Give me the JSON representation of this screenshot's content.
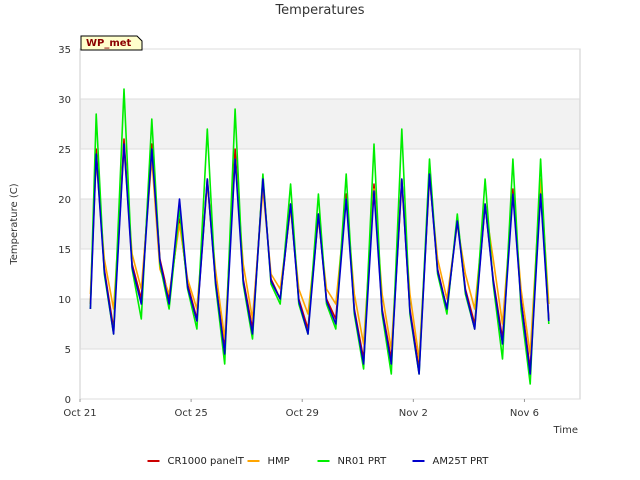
{
  "chart_data": {
    "type": "line",
    "title": "Temperatures",
    "xlabel": "Time",
    "ylabel": "Temperature (C)",
    "badge": "WP_met",
    "ylim": [
      0,
      35
    ],
    "yticks": [
      0,
      5,
      10,
      15,
      20,
      25,
      30,
      35
    ],
    "xlim": [
      "2024-10-21",
      "2024-11-08"
    ],
    "xticks": [
      {
        "date": "2024-10-21",
        "label": "Oct 21"
      },
      {
        "date": "2024-10-25",
        "label": "Oct 25"
      },
      {
        "date": "2024-10-29",
        "label": "Oct 29"
      },
      {
        "date": "2024-11-02",
        "label": "Nov 2"
      },
      {
        "date": "2024-11-06",
        "label": "Nov 6"
      }
    ],
    "grid": true,
    "legend_position": "bottom",
    "x": [
      "2024-10-21 09:00",
      "2024-10-21 14:00",
      "2024-10-21 21:00",
      "2024-10-22 05:00",
      "2024-10-22 14:00",
      "2024-10-22 21:00",
      "2024-10-23 05:00",
      "2024-10-23 14:00",
      "2024-10-23 21:00",
      "2024-10-24 05:00",
      "2024-10-24 14:00",
      "2024-10-24 21:00",
      "2024-10-25 05:00",
      "2024-10-25 14:00",
      "2024-10-25 21:00",
      "2024-10-26 05:00",
      "2024-10-26 14:00",
      "2024-10-26 21:00",
      "2024-10-27 05:00",
      "2024-10-27 14:00",
      "2024-10-27 21:00",
      "2024-10-28 05:00",
      "2024-10-28 14:00",
      "2024-10-28 21:00",
      "2024-10-29 05:00",
      "2024-10-29 14:00",
      "2024-10-29 21:00",
      "2024-10-30 05:00",
      "2024-10-30 14:00",
      "2024-10-30 21:00",
      "2024-10-31 05:00",
      "2024-10-31 14:00",
      "2024-10-31 21:00",
      "2024-11-01 05:00",
      "2024-11-01 14:00",
      "2024-11-01 21:00",
      "2024-11-02 05:00",
      "2024-11-02 14:00",
      "2024-11-02 21:00",
      "2024-11-03 05:00",
      "2024-11-03 14:00",
      "2024-11-03 21:00",
      "2024-11-04 05:00",
      "2024-11-04 14:00",
      "2024-11-04 21:00",
      "2024-11-05 05:00",
      "2024-11-05 14:00",
      "2024-11-05 21:00",
      "2024-11-06 05:00",
      "2024-11-06 14:00",
      "2024-11-06 21:00",
      "2024-11-07 05:00",
      "2024-11-07 14:00",
      "2024-11-07 21:00"
    ],
    "series": [
      {
        "name": "CR1000 panelT",
        "color": "#cc0000",
        "values": [
          9.5,
          25.0,
          13.0,
          7.0,
          26.0,
          13.5,
          10.0,
          25.5,
          14.0,
          10.0,
          18.0,
          11.5,
          8.0,
          22.0,
          12.0,
          5.0,
          25.0,
          12.0,
          7.0,
          22.0,
          12.0,
          10.0,
          19.5,
          10.0,
          7.0,
          18.5,
          10.0,
          8.0,
          20.5,
          9.0,
          4.0,
          21.5,
          9.0,
          4.0,
          22.0,
          9.0,
          3.0,
          22.5,
          13.0,
          9.0,
          18.0,
          11.0,
          7.5,
          19.5,
          12.0,
          6.0,
          21.0,
          10.0,
          3.0,
          21.0,
          8.0
        ]
      },
      {
        "name": "HMP",
        "color": "#ffa500",
        "values": [
          10.5,
          24.0,
          14.0,
          9.0,
          25.0,
          14.5,
          11.0,
          24.0,
          13.0,
          10.5,
          17.5,
          12.0,
          9.0,
          21.5,
          13.0,
          6.0,
          24.0,
          13.5,
          8.0,
          21.0,
          12.5,
          11.0,
          19.0,
          11.0,
          8.5,
          18.0,
          11.0,
          9.5,
          20.0,
          10.5,
          5.5,
          21.0,
          10.5,
          5.0,
          21.5,
          10.5,
          4.0,
          22.0,
          14.0,
          10.0,
          17.5,
          12.5,
          9.0,
          19.5,
          14.0,
          7.5,
          20.5,
          11.0,
          4.5,
          22.0,
          9.5
        ]
      },
      {
        "name": "NR01 PRT",
        "color": "#00ee00",
        "values": [
          9.0,
          28.5,
          12.5,
          6.5,
          31.0,
          13.0,
          8.0,
          28.0,
          13.5,
          9.0,
          19.0,
          11.0,
          7.0,
          27.0,
          11.5,
          3.5,
          29.0,
          11.5,
          6.0,
          22.5,
          11.5,
          9.5,
          21.5,
          9.5,
          6.5,
          20.5,
          9.5,
          7.0,
          22.5,
          8.5,
          3.0,
          25.5,
          8.5,
          2.5,
          27.0,
          8.5,
          2.5,
          24.0,
          12.5,
          8.5,
          18.5,
          10.5,
          7.0,
          22.0,
          11.5,
          4.0,
          24.0,
          9.0,
          1.5,
          24.0,
          7.5
        ]
      },
      {
        "name": "AM25T PRT",
        "color": "#0000cc",
        "values": [
          9.0,
          24.5,
          12.8,
          6.5,
          25.5,
          13.2,
          9.5,
          25.0,
          13.8,
          9.5,
          20.0,
          11.2,
          7.8,
          22.0,
          11.8,
          4.5,
          24.0,
          11.8,
          6.5,
          22.0,
          11.8,
          10.0,
          19.5,
          9.8,
          6.5,
          18.5,
          9.8,
          7.5,
          20.0,
          8.8,
          3.5,
          20.8,
          8.8,
          3.5,
          22.0,
          8.8,
          2.5,
          22.5,
          12.8,
          9.0,
          17.8,
          10.8,
          7.0,
          19.5,
          11.8,
          5.5,
          20.5,
          9.8,
          2.5,
          20.5,
          7.8
        ]
      }
    ]
  }
}
